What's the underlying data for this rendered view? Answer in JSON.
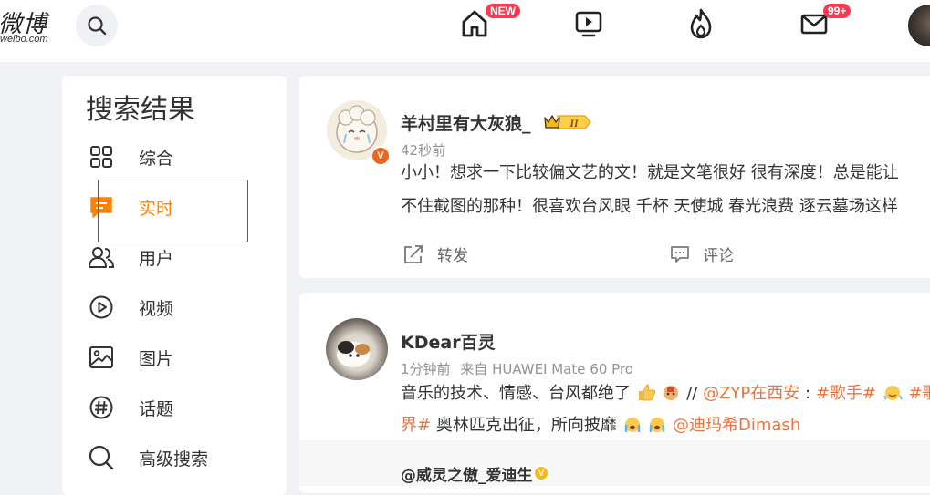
{
  "header": {
    "logo_text": "微博",
    "logo_domain": "weibo.com",
    "home_badge": "NEW",
    "messages_badge": "99+"
  },
  "sidebar": {
    "title": "搜索结果",
    "items": [
      {
        "label": "综合",
        "icon": "grid-icon"
      },
      {
        "label": "实时",
        "icon": "chat-icon",
        "active": true
      },
      {
        "label": "用户",
        "icon": "users-icon"
      },
      {
        "label": "视频",
        "icon": "play-circle-icon"
      },
      {
        "label": "图片",
        "icon": "image-icon"
      },
      {
        "label": "话题",
        "icon": "hashtag-icon"
      },
      {
        "label": "高级搜索",
        "icon": "search-icon"
      }
    ]
  },
  "posts": [
    {
      "author": "羊村里有大灰狼_",
      "time": "42秒前",
      "text_line1": "小小！想求一下比较偏文艺的文！就是文笔很好 很有深度！总是能让",
      "text_line2": "不住截图的那种！很喜欢台风眼 千杯 天使城 春光浪费 逐云墓场这样",
      "repost_label": "转发",
      "comment_label": "评论",
      "vip_level": "II"
    },
    {
      "author": "KDear百灵",
      "time": "1分钟前",
      "source": "来自 HUAWEI Mate 60 Pro",
      "text_part1": "音乐的技术、情感、台风都绝了",
      "text_part2": " //",
      "mention1": "@ZYP在西安",
      "text_part3": ":",
      "tag1": "#歌手#",
      "tag2_head": "#歌",
      "tag2_tail": "界#",
      "text_part4": " 奥林匹克出征，所向披靡",
      "mention2": "@迪玛希Dimash",
      "repost_author": "@威灵之傲_爱迪生"
    }
  ]
}
